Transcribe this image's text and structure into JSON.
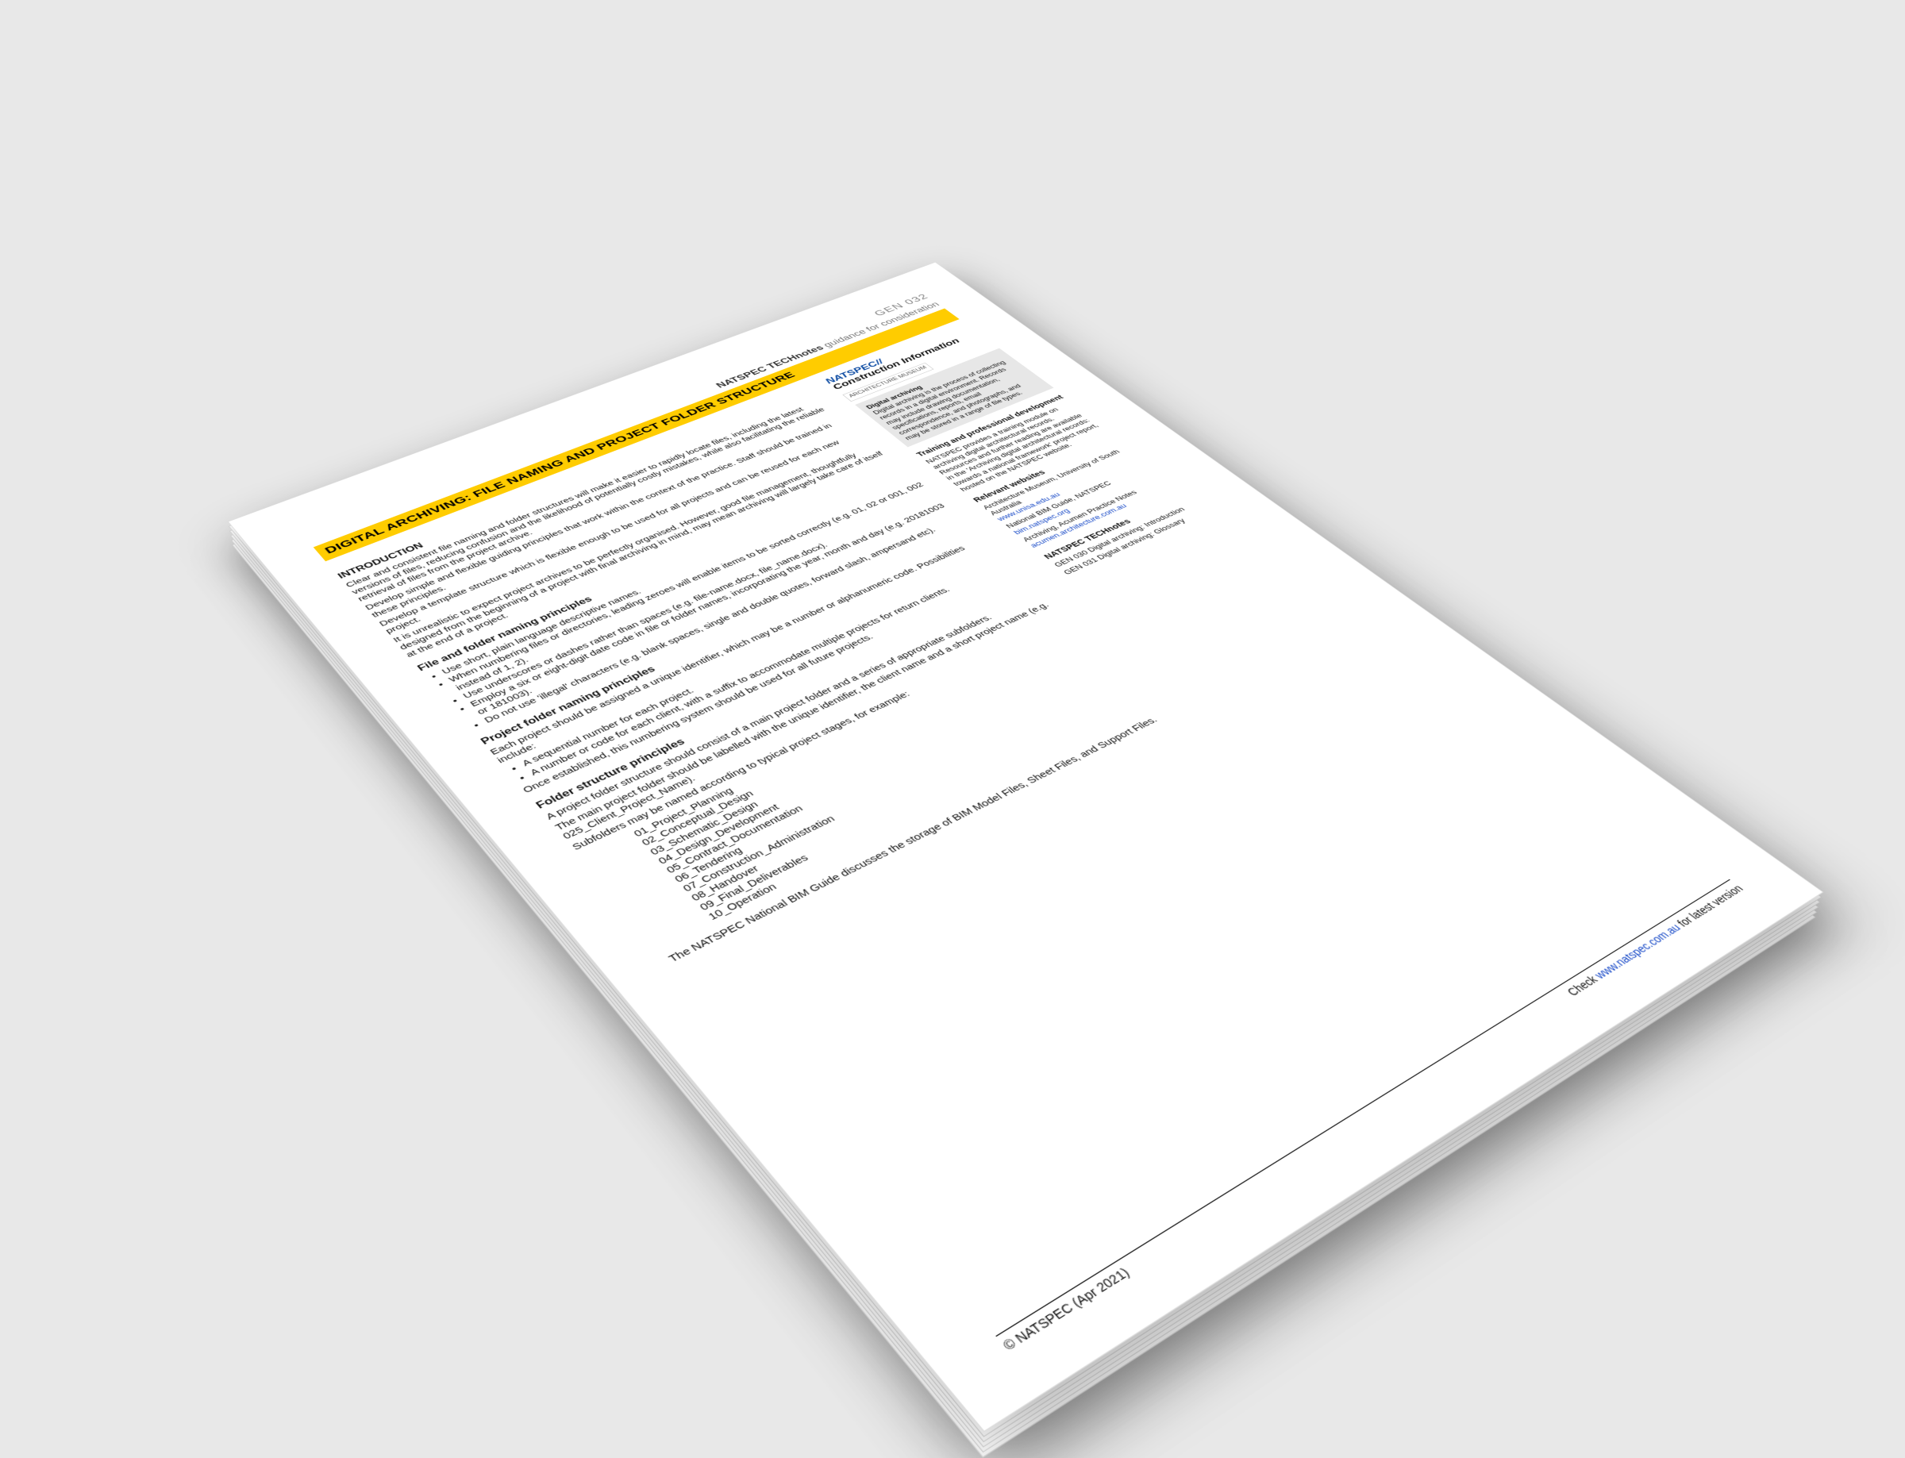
{
  "header": {
    "code": "GEN 032",
    "technotes_prefix": "NATSPEC TECHnotes",
    "technotes_suffix": " guidance for consideration",
    "title": "DIGITAL ARCHIVING: FILE NAMING AND PROJECT FOLDER STRUCTURE"
  },
  "intro": {
    "heading": "INTRODUCTION",
    "p1": "Clear and consistent file naming and folder structures will make it easier to rapidly locate files, including the latest versions of files, reducing confusion and the likelihood of potentially costly mistakes, while also facilitating the reliable retrieval of files from the project archive.",
    "p2": "Develop simple and flexible guiding principles that work within the context of the practice. Staff should be trained in these principles.",
    "p3": "Develop a template structure which is flexible enough to be used for all projects and can be reused for each new project.",
    "p4": "It is unrealistic to expect project archives to be perfectly organised. However, good file management, thoughtfully designed from the beginning of a project with final archiving in mind, may mean archiving will largely take care of itself at the end of a project."
  },
  "file_principles": {
    "heading": "File and folder naming principles",
    "items": [
      "Use short, plain language descriptive names.",
      "When numbering files or directories, leading zeroes will enable items to be sorted correctly (e.g. 01, 02 or 001, 002 instead of 1, 2).",
      "Use underscores or dashes rather than spaces (e.g. file-name.docx, file_name.docx).",
      "Employ a six or eight-digit date code in file or folder names, incorporating the year, month and day (e.g. 20181003 or 181003).",
      "Do not use 'illegal' characters (e.g. blank spaces, single and double quotes, forward slash, ampersand etc)."
    ]
  },
  "project_principles": {
    "heading": "Project folder naming principles",
    "p1": "Each project should be assigned a unique identifier, which may be a number or alphanumeric code. Possibilities include:",
    "items": [
      "A sequential number for each project.",
      "A number or code for each client, with a suffix to accommodate multiple projects for return clients."
    ],
    "p2": "Once established, this numbering system should be used for all future projects."
  },
  "folder_structure": {
    "heading": "Folder structure principles",
    "p1": "A project folder structure should consist of a main project folder and a series of appropriate subfolders.",
    "p2": "The main project folder should be labelled with the unique identifier, the client name and a short project name (e.g. 025_Client_Project_Name).",
    "p3": "Subfolders may be named according to typical project stages, for example:",
    "subfolders": [
      "01_Project_Planning",
      "02_Conceptual_Design",
      "03_Schematic_Design",
      "04_Design_Development",
      "05_Contract_Documentation",
      "06_Tendering",
      "07_Construction_Administration",
      "08_Handover",
      "09_Final_Deliverables",
      "10_Operation"
    ],
    "p4": "The NATSPEC National BIM Guide discusses the storage of BIM Model Files, Sheet Files, and Support Files."
  },
  "sidebar": {
    "brand_nat": "NATSPEC//",
    "brand_ci": "Construction Information",
    "uni_logo": "ARCHITECTURE MUSEUM",
    "definition_title": "Digital archiving",
    "definition_body": "Digital archiving is the process of collecting records in a digital environment. Records may include drawing documentation, specifications, reports, email correspondence, and photographs, and may be stored in a range of file types.",
    "training_heading": "Training and professional development",
    "training_body": "NATSPEC provides a training module on archiving digital architectural records. Resources and further reading are available in the 'Archiving digital architectural records: towards a national framework' project report, hosted on the NATSPEC website.",
    "websites_heading": "Relevant websites",
    "website1_label": "Architecture Museum, University of South Australia",
    "website1_link": "www.unisa.edu.au",
    "website2_label": "National BIM Guide, NATSPEC",
    "website2_link": "bim.natspec.org",
    "website3_label": "Archiving, Acumen Practice Notes",
    "website3_link": "acumen.architecture.com.au",
    "technotes_heading": "NATSPEC TECHnotes",
    "technote1": "GEN 030 Digital archiving: Introduction",
    "technote2": "GEN 031 Digital archiving: Glossary"
  },
  "footer": {
    "left": "© NATSPEC (Apr 2021)",
    "right_prefix": "Check ",
    "right_link": "www.natspec.com.au",
    "right_suffix": " for latest version"
  }
}
